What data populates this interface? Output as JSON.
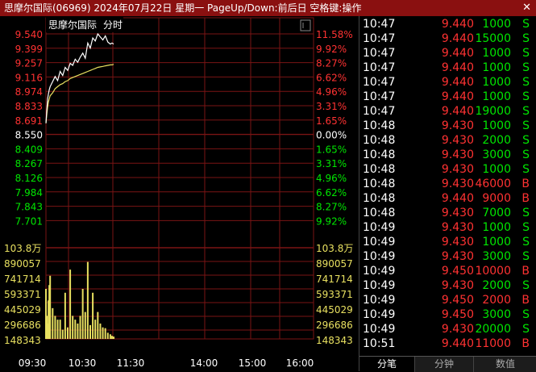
{
  "window": {
    "title": "思摩尔国际(06969) 2024年07月22日 星期一 PageUp/Down:前后日 空格键:操作",
    "close_glyph": "✕"
  },
  "chart_header": {
    "name": "思摩尔国际",
    "mode": "分时"
  },
  "price_axis": {
    "left_labels": [
      "9.540",
      "9.399",
      "9.257",
      "9.116",
      "8.974",
      "8.833",
      "8.691",
      "8.550",
      "8.409",
      "8.267",
      "8.126",
      "7.984",
      "7.843",
      "7.701"
    ],
    "right_labels": [
      "11.58%",
      "9.92%",
      "8.27%",
      "6.62%",
      "4.96%",
      "3.31%",
      "1.65%",
      "0.00%",
      "1.65%",
      "3.31%",
      "4.96%",
      "6.62%",
      "8.27%",
      "9.92%"
    ]
  },
  "volume_axis": {
    "labels": [
      "103.8万",
      "890057",
      "741714",
      "593371",
      "445029",
      "296686",
      "148343"
    ]
  },
  "time_axis": {
    "labels": [
      "09:30",
      "10:30",
      "11:30",
      "14:00",
      "15:00",
      "16:00"
    ]
  },
  "colors": {
    "up": "#ff3232",
    "down": "#00e600",
    "flat": "#ffffff",
    "price_line": "#ffffff",
    "avg_line": "#e8e060",
    "volume": "#e8e060",
    "grid": "#7a1414",
    "title_bg": "#8a1010"
  },
  "chart_data": {
    "type": "line",
    "x": [
      "09:30",
      "09:31",
      "09:32",
      "09:33",
      "09:34",
      "09:35",
      "09:38",
      "09:41",
      "09:44",
      "09:47",
      "09:50",
      "09:53",
      "09:56",
      "09:59",
      "10:02",
      "10:05",
      "10:08",
      "10:11",
      "10:14",
      "10:17",
      "10:20",
      "10:23",
      "10:26",
      "10:29",
      "10:32",
      "10:35",
      "10:38",
      "10:41",
      "10:44",
      "10:47",
      "10:49",
      "10:51"
    ],
    "series": [
      {
        "values": [
          8.66,
          8.78,
          8.9,
          8.95,
          8.99,
          9.02,
          9.07,
          9.12,
          9.08,
          9.17,
          9.13,
          9.21,
          9.18,
          9.25,
          9.23,
          9.29,
          9.26,
          9.31,
          9.35,
          9.3,
          9.45,
          9.4,
          9.5,
          9.47,
          9.54,
          9.51,
          9.48,
          9.52,
          9.46,
          9.44,
          9.45,
          9.44
        ]
      },
      {
        "values": [
          8.66,
          8.74,
          8.82,
          8.87,
          8.9,
          8.93,
          8.96,
          9.0,
          9.02,
          9.04,
          9.05,
          9.07,
          9.08,
          9.1,
          9.11,
          9.12,
          9.13,
          9.14,
          9.15,
          9.16,
          9.17,
          9.18,
          9.19,
          9.2,
          9.21,
          9.215,
          9.22,
          9.225,
          9.23,
          9.235,
          9.235,
          9.24
        ]
      }
    ],
    "volume": [
      650000,
      300000,
      200000,
      500000,
      700000,
      820000,
      400000,
      300000,
      250000,
      250000,
      120000,
      600000,
      150000,
      900000,
      300000,
      250000,
      200000,
      300000,
      650000,
      350000,
      1000000,
      180000,
      600000,
      250000,
      350000,
      200000,
      150000,
      140000,
      80000,
      60000,
      40000,
      30000
    ],
    "ylim": [
      7.56,
      9.54
    ],
    "volume_ylim": [
      0,
      1038000
    ]
  },
  "ticks": [
    {
      "time": "10:47",
      "price": "9.440",
      "vol": "1000",
      "dir": "S"
    },
    {
      "time": "10:47",
      "price": "9.440",
      "vol": "15000",
      "dir": "S"
    },
    {
      "time": "10:47",
      "price": "9.440",
      "vol": "1000",
      "dir": "S"
    },
    {
      "time": "10:47",
      "price": "9.440",
      "vol": "1000",
      "dir": "S"
    },
    {
      "time": "10:47",
      "price": "9.440",
      "vol": "1000",
      "dir": "S"
    },
    {
      "time": "10:47",
      "price": "9.440",
      "vol": "1000",
      "dir": "S"
    },
    {
      "time": "10:47",
      "price": "9.440",
      "vol": "19000",
      "dir": "S"
    },
    {
      "time": "10:48",
      "price": "9.430",
      "vol": "1000",
      "dir": "S"
    },
    {
      "time": "10:48",
      "price": "9.430",
      "vol": "2000",
      "dir": "S"
    },
    {
      "time": "10:48",
      "price": "9.430",
      "vol": "3000",
      "dir": "S"
    },
    {
      "time": "10:48",
      "price": "9.430",
      "vol": "1000",
      "dir": "S"
    },
    {
      "time": "10:48",
      "price": "9.430",
      "vol": "46000",
      "dir": "B"
    },
    {
      "time": "10:48",
      "price": "9.440",
      "vol": "9000",
      "dir": "B"
    },
    {
      "time": "10:48",
      "price": "9.430",
      "vol": "7000",
      "dir": "S"
    },
    {
      "time": "10:49",
      "price": "9.430",
      "vol": "1000",
      "dir": "S"
    },
    {
      "time": "10:49",
      "price": "9.430",
      "vol": "1000",
      "dir": "S"
    },
    {
      "time": "10:49",
      "price": "9.430",
      "vol": "3000",
      "dir": "S"
    },
    {
      "time": "10:49",
      "price": "9.450",
      "vol": "10000",
      "dir": "B"
    },
    {
      "time": "10:49",
      "price": "9.430",
      "vol": "2000",
      "dir": "S"
    },
    {
      "time": "10:49",
      "price": "9.450",
      "vol": "2000",
      "dir": "B"
    },
    {
      "time": "10:49",
      "price": "9.450",
      "vol": "3000",
      "dir": "S"
    },
    {
      "time": "10:49",
      "price": "9.430",
      "vol": "20000",
      "dir": "S"
    },
    {
      "time": "10:51",
      "price": "9.440",
      "vol": "11000",
      "dir": "B"
    }
  ],
  "tabs": [
    "分笔",
    "分钟",
    "数值"
  ]
}
